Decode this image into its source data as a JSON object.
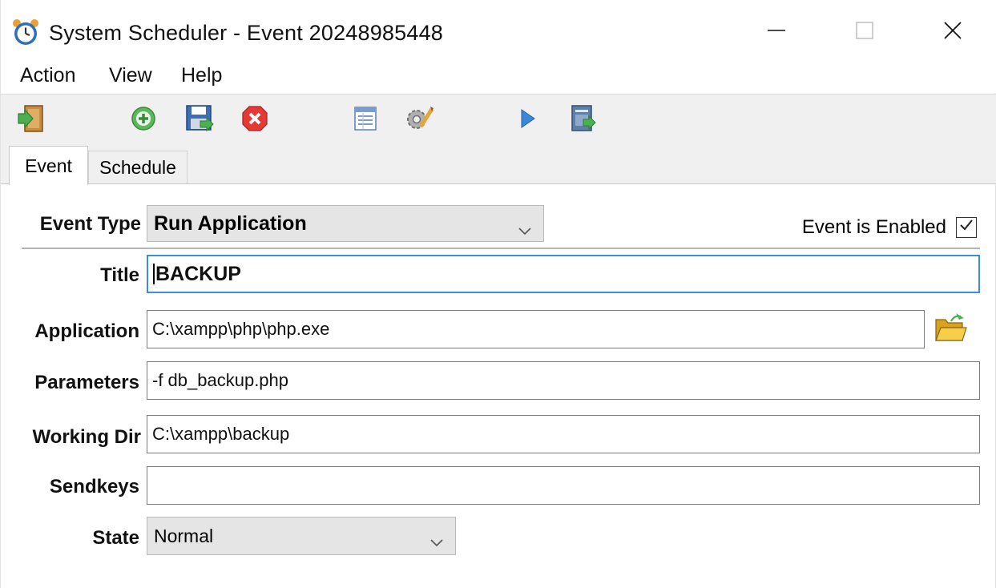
{
  "window": {
    "title": "System Scheduler - Event 20248985448",
    "controls": {
      "minimize": "minimize-icon",
      "maximize": "maximize-icon",
      "close": "close-icon"
    }
  },
  "menu": {
    "items": [
      {
        "label": "Action"
      },
      {
        "label": "View"
      },
      {
        "label": "Help"
      }
    ]
  },
  "toolbar": {
    "buttons": [
      {
        "icon": "exit-door-icon"
      },
      {
        "icon": "add-icon"
      },
      {
        "icon": "save-icon"
      },
      {
        "icon": "delete-icon"
      },
      {
        "icon": "list-icon"
      },
      {
        "icon": "settings-icon"
      },
      {
        "icon": "run-icon"
      },
      {
        "icon": "export-icon"
      }
    ]
  },
  "tabs": [
    {
      "label": "Event",
      "active": true
    },
    {
      "label": "Schedule",
      "active": false
    }
  ],
  "form": {
    "event_type": {
      "label": "Event Type",
      "value": "Run Application"
    },
    "enabled": {
      "label": "Event is Enabled",
      "checked": true
    },
    "title": {
      "label": "Title",
      "value": "BACKUP"
    },
    "application": {
      "label": "Application",
      "value": "C:\\xampp\\php\\php.exe",
      "browse_icon": "folder-open-icon"
    },
    "parameters": {
      "label": "Parameters",
      "value": "-f db_backup.php"
    },
    "working_dir": {
      "label": "Working Dir",
      "value": "C:\\xampp\\backup"
    },
    "sendkeys": {
      "label": "Sendkeys",
      "value": ""
    },
    "state": {
      "label": "State",
      "value": "Normal"
    }
  },
  "colors": {
    "toolbar_bg": "#f0f0f0",
    "focus_border": "#3c8fd6",
    "select_bg": "#e5e5e5"
  }
}
